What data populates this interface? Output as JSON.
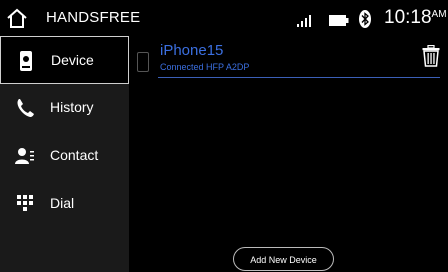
{
  "header": {
    "title": "HANDSFREE",
    "time": "10:18",
    "ampm": "AM",
    "icons": [
      "home-icon",
      "signal-icon",
      "battery-icon",
      "bluetooth-icon"
    ]
  },
  "sidebar": {
    "items": [
      {
        "label": "Device",
        "icon": "phone-icon",
        "active": true
      },
      {
        "label": "History",
        "icon": "call-handset-icon",
        "active": false
      },
      {
        "label": "Contact",
        "icon": "contact-icon",
        "active": false
      },
      {
        "label": "Dial",
        "icon": "dialpad-icon",
        "active": false
      }
    ]
  },
  "device": {
    "name": "iPhone15",
    "status": "Connected HFP A2DP",
    "icons": [
      "phone-outline-icon",
      "trash-icon"
    ]
  },
  "actions": {
    "add_label": "Add New Device"
  },
  "colors": {
    "accent": "#3b6fe0",
    "background": "#000000",
    "sidebar": "#1a1a1a"
  }
}
